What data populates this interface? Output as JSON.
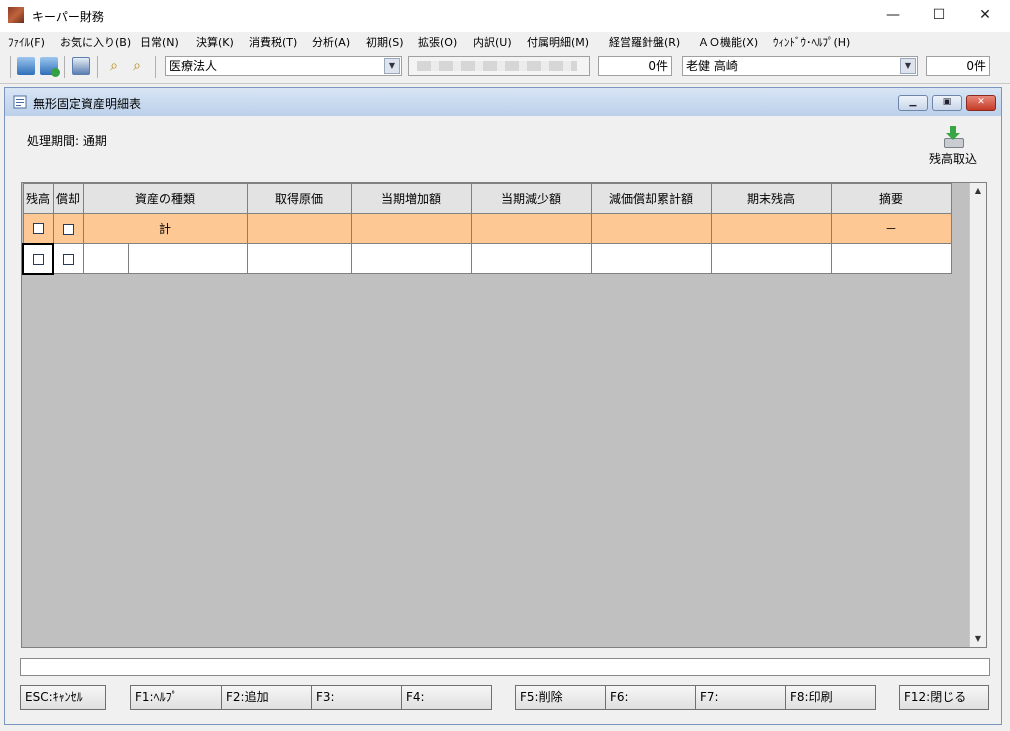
{
  "window": {
    "title": "キーパー財務"
  },
  "menu": [
    "ﾌｧｲﾙ(F)",
    "お気に入り(B)",
    "日常(N)",
    "決算(K)",
    "消費税(T)",
    "分析(A)",
    "初期(S)",
    "拡張(O)",
    "内訳(U)",
    "付属明細(M)",
    "経営羅針盤(R)",
    "ＡＯ機能(X)",
    "ｳｨﾝﾄﾞｳ･ﾍﾙﾌﾟ(H)"
  ],
  "toolbar": {
    "corp_type": "医療法人",
    "count1": "0件",
    "user_combo": "老健 高崎",
    "count2": "0件"
  },
  "child": {
    "title": "無形固定資産明細表",
    "period": "処理期間: 通期",
    "import_label": "残高取込"
  },
  "grid": {
    "headers": [
      "残高",
      "償却",
      "資産の種類",
      "取得原価",
      "当期増加額",
      "当期減少額",
      "減価償却累計額",
      "期末残高",
      "摘要"
    ],
    "total_label": "計",
    "total_note": "－"
  },
  "fkeys": [
    "ESC:ｷｬﾝｾﾙ",
    "F1:ﾍﾙﾌﾟ",
    "F2:追加",
    "F3:",
    "F4:",
    "F5:削除",
    "F6:",
    "F7:",
    "F8:印刷",
    "F12:閉じる"
  ]
}
